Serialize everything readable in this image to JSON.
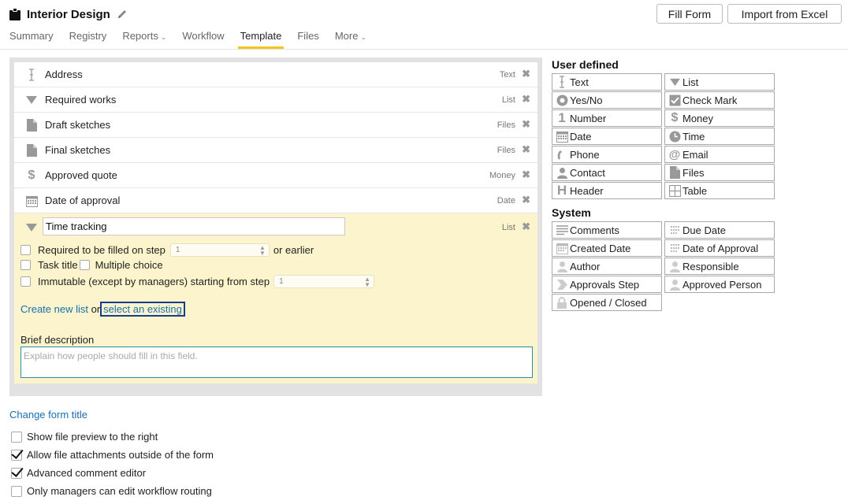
{
  "header": {
    "title": "Interior Design",
    "fill_form": "Fill Form",
    "import_excel": "Import from Excel"
  },
  "nav": {
    "summary": "Summary",
    "registry": "Registry",
    "reports": "Reports",
    "workflow": "Workflow",
    "template": "Template",
    "files": "Files",
    "more": "More",
    "active": "Template"
  },
  "form_fields": [
    {
      "label": "Address",
      "type": "Text",
      "icon": "text-cursor-icon"
    },
    {
      "label": "Required works",
      "type": "List",
      "icon": "triangle-down-icon"
    },
    {
      "label": "Draft sketches",
      "type": "Files",
      "icon": "file-icon"
    },
    {
      "label": "Final sketches",
      "type": "Files",
      "icon": "file-icon"
    },
    {
      "label": "Approved quote",
      "type": "Money",
      "icon": "dollar-icon"
    },
    {
      "label": "Date of approval",
      "type": "Date",
      "icon": "calendar-icon"
    }
  ],
  "active_field": {
    "name": "Time tracking",
    "type": "List",
    "required_label": "Required to be filled on step",
    "required_step": "1",
    "or_earlier": "or earlier",
    "task_title": "Task title",
    "multiple_choice": "Multiple choice",
    "immutable_label": "Immutable (except by managers) starting from step",
    "immutable_step": "1",
    "create_new_list": "Create new list",
    "or": "or",
    "select_existing": "select an existing",
    "brief_description": "Brief description",
    "description_placeholder": "Explain how people should fill in this field."
  },
  "change_form_title": "Change form title",
  "options": [
    {
      "label": "Show file preview to the right",
      "checked": false
    },
    {
      "label": "Allow file attachments outside of the form",
      "checked": true
    },
    {
      "label": "Advanced comment editor",
      "checked": true
    },
    {
      "label": "Only managers can edit workflow routing",
      "checked": false
    }
  ],
  "palette": {
    "user_defined_heading": "User defined",
    "user_defined": [
      {
        "label": "Text",
        "icon": "text-cursor-icon"
      },
      {
        "label": "List",
        "icon": "triangle-down-icon"
      },
      {
        "label": "Yes/No",
        "icon": "radio-icon"
      },
      {
        "label": "Check Mark",
        "icon": "checkmark-icon"
      },
      {
        "label": "Number",
        "icon": "number-one-icon"
      },
      {
        "label": "Money",
        "icon": "dollar-icon"
      },
      {
        "label": "Date",
        "icon": "calendar-icon"
      },
      {
        "label": "Time",
        "icon": "clock-icon"
      },
      {
        "label": "Phone",
        "icon": "phone-icon"
      },
      {
        "label": "Email",
        "icon": "at-icon"
      },
      {
        "label": "Contact",
        "icon": "person-icon"
      },
      {
        "label": "Files",
        "icon": "file-icon"
      },
      {
        "label": "Header",
        "icon": "header-icon"
      },
      {
        "label": "Table",
        "icon": "table-icon"
      }
    ],
    "system_heading": "System",
    "system": [
      {
        "label": "Comments",
        "icon": "comments-icon"
      },
      {
        "label": "Due Date",
        "icon": "calendar-dotted-icon"
      },
      {
        "label": "Created Date",
        "icon": "calendar-icon"
      },
      {
        "label": "Date of Approval",
        "icon": "calendar-dotted-icon"
      },
      {
        "label": "Author",
        "icon": "person-icon"
      },
      {
        "label": "Responsible",
        "icon": "person-icon"
      },
      {
        "label": "Approvals Step",
        "icon": "step-arrow-icon"
      },
      {
        "label": "Approved Person",
        "icon": "person-icon"
      },
      {
        "label": "Opened / Closed",
        "icon": "lock-icon"
      }
    ]
  },
  "colors": {
    "accent_underline": "#f0c419",
    "active_field_bg": "#fbf4cc",
    "link": "#1a6eb0"
  }
}
